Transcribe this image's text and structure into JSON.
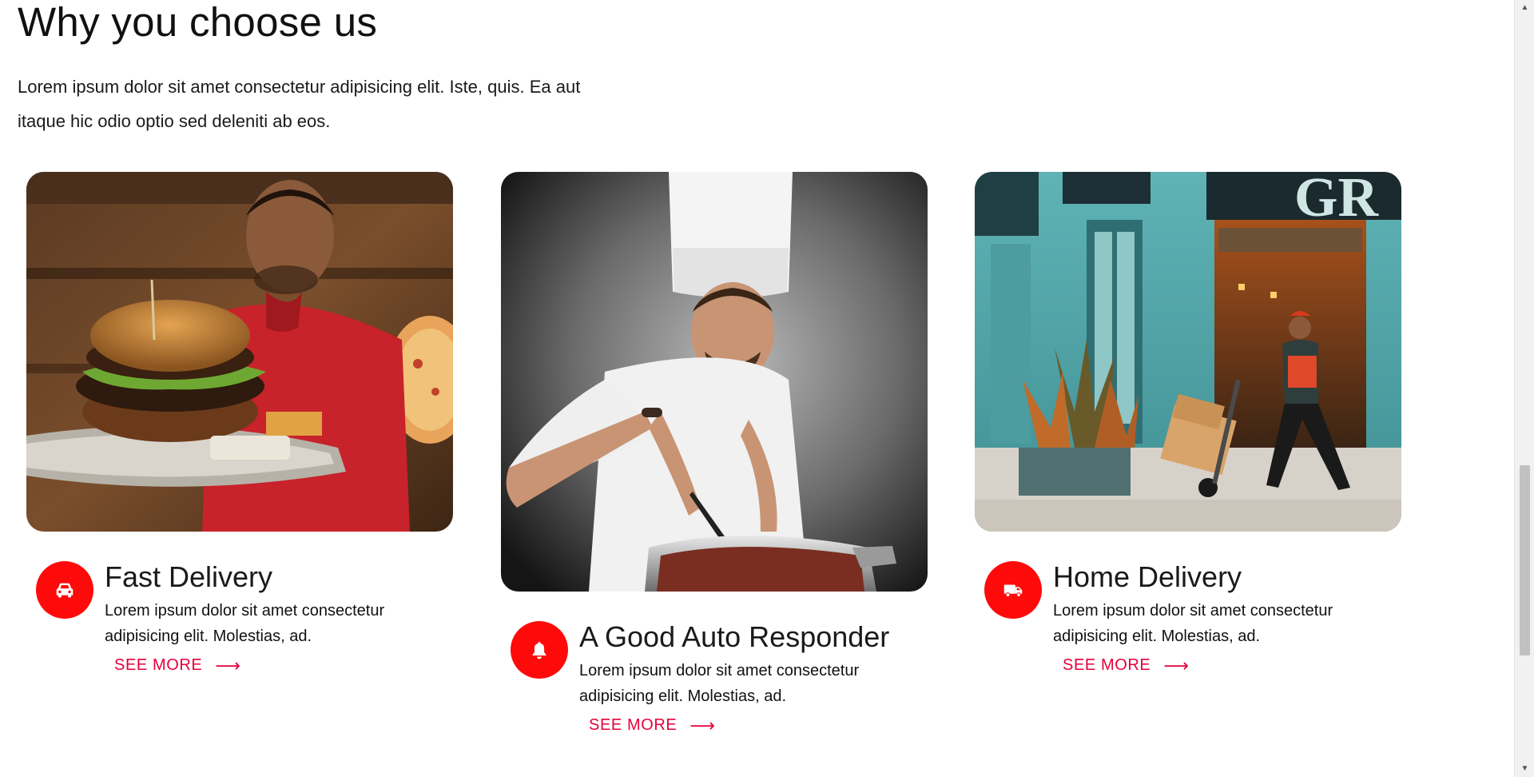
{
  "section": {
    "title": "Why you choose us",
    "lead": "Lorem ipsum dolor sit amet consectetur adipisicing elit. Iste, quis. Ea aut itaque hic odio optio sed deleniti ab eos."
  },
  "cards": [
    {
      "title": "Fast Delivery",
      "text": "Lorem ipsum dolor sit amet consectetur adipisicing elit. Molestias, ad.",
      "link_label": "SEE MORE",
      "icon": "car-icon"
    },
    {
      "title": "A Good Auto Responder",
      "text": "Lorem ipsum dolor sit amet consectetur adipisicing elit. Molestias, ad.",
      "link_label": "SEE MORE",
      "icon": "bell-icon"
    },
    {
      "title": "Home Delivery",
      "text": "Lorem ipsum dolor sit amet consectetur adipisicing elit. Molestias, ad.",
      "link_label": "SEE MORE",
      "icon": "truck-icon"
    }
  ],
  "colors": {
    "accent": "#ff0a0a",
    "link": "#e4003a",
    "text": "#111111"
  }
}
